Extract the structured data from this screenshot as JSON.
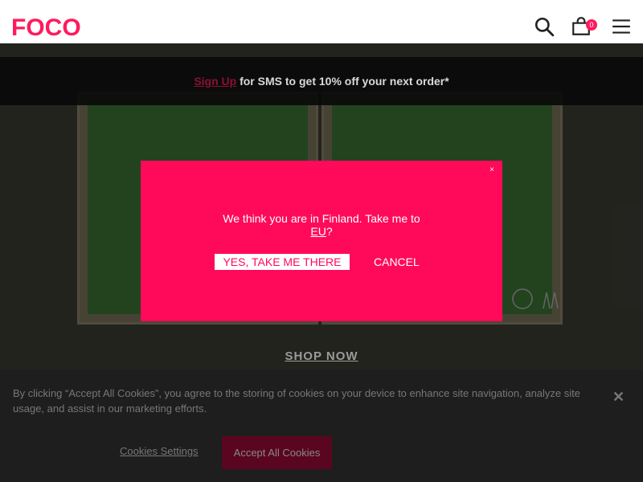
{
  "header": {
    "logo_text": "FOCO",
    "cart_count": "0",
    "icons": [
      "search-icon",
      "cart-icon",
      "menu-icon"
    ]
  },
  "promo": {
    "signup_label": "Sign Up",
    "text": " for SMS to get 10% off your next order*"
  },
  "hero": {
    "cta_label": "SHOP NOW"
  },
  "modal": {
    "close_label": "×",
    "message": "We think you are in Finland. Take me to",
    "link": "EU",
    "suffix": "?",
    "confirm_label": "YES, TAKE ME THERE",
    "cancel_label": "CANCEL"
  },
  "cookie": {
    "text": "By clicking “Accept All Cookies”, you agree to the storing of cookies on your device to enhance site navigation, analyze site usage, and assist in our marketing efforts.",
    "settings_label": "Cookies Settings",
    "accept_label": "Accept All Cookies",
    "close_label": "✕"
  },
  "colors": {
    "brand": "#ff0a5a",
    "cookie_accept": "#5a0620",
    "banner": "#1e1e1e"
  }
}
